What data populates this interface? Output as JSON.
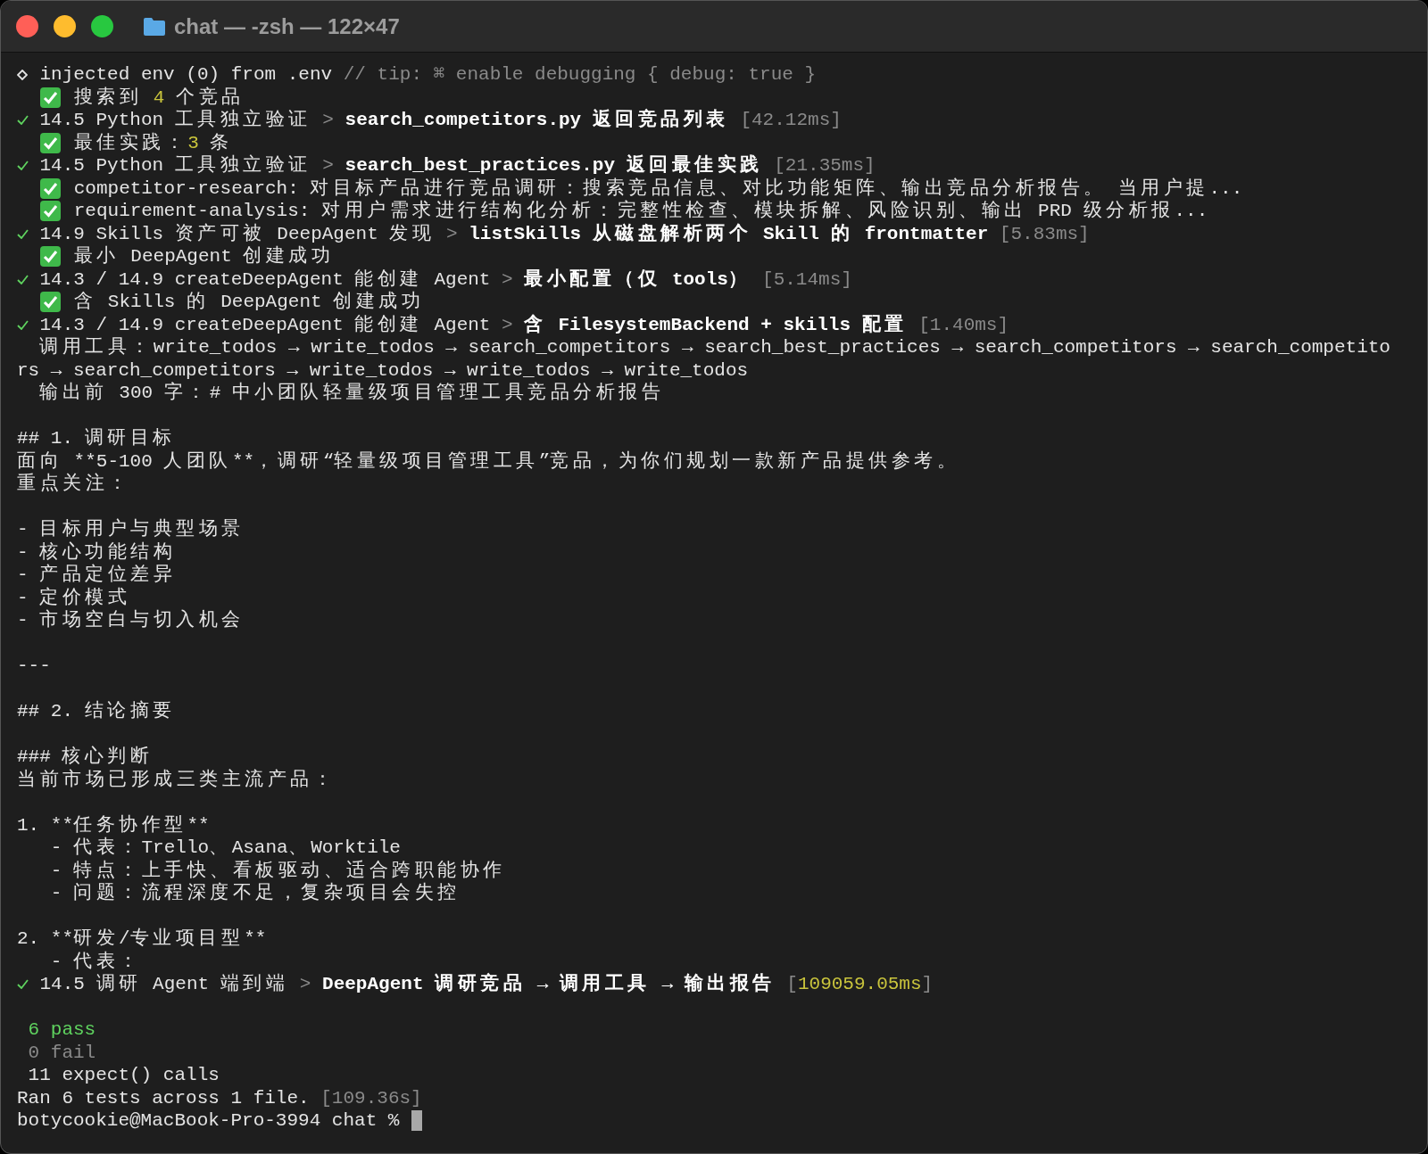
{
  "window": {
    "title": "chat — -zsh — 122×47"
  },
  "lines": [
    {
      "kind": "diamond",
      "segments": [
        {
          "text": "injected env (0) from .env ",
          "kind": "plain"
        },
        {
          "text": "// tip: ⌘ enable debugging { debug: true }",
          "kind": "dim"
        }
      ]
    },
    {
      "kind": "emoji",
      "segments": [
        {
          "text": "搜索到 ",
          "kind": "plain"
        },
        {
          "text": "4",
          "kind": "yellow"
        },
        {
          "text": " 个竞品",
          "kind": "plain"
        }
      ]
    },
    {
      "kind": "tick",
      "segments": [
        {
          "text": "14.5 Python 工具独立验证 ",
          "kind": "plain"
        },
        {
          "text": "> ",
          "kind": "dim"
        },
        {
          "text": "search_competitors.py 返回竞品列表",
          "kind": "bold"
        },
        {
          "text": " [42.12ms]",
          "kind": "dim"
        }
      ]
    },
    {
      "kind": "emoji",
      "segments": [
        {
          "text": "最佳实践：",
          "kind": "plain"
        },
        {
          "text": "3",
          "kind": "yellow"
        },
        {
          "text": " 条",
          "kind": "plain"
        }
      ]
    },
    {
      "kind": "tick",
      "segments": [
        {
          "text": "14.5 Python 工具独立验证 ",
          "kind": "plain"
        },
        {
          "text": "> ",
          "kind": "dim"
        },
        {
          "text": "search_best_practices.py 返回最佳实践",
          "kind": "bold"
        },
        {
          "text": " [21.35ms]",
          "kind": "dim"
        }
      ]
    },
    {
      "kind": "emoji",
      "segments": [
        {
          "text": "competitor-research: 对目标产品进行竞品调研：搜索竞品信息、对比功能矩阵、输出竞品分析报告。 当用户提...",
          "kind": "plain"
        }
      ]
    },
    {
      "kind": "emoji",
      "segments": [
        {
          "text": "requirement-analysis: 对用户需求进行结构化分析：完整性检查、模块拆解、风险识别、输出 PRD 级分析报...",
          "kind": "plain"
        }
      ]
    },
    {
      "kind": "tick",
      "segments": [
        {
          "text": "14.9 Skills 资产可被 DeepAgent 发现 ",
          "kind": "plain"
        },
        {
          "text": "> ",
          "kind": "dim"
        },
        {
          "text": "listSkills 从磁盘解析两个 Skill 的 frontmatter",
          "kind": "bold"
        },
        {
          "text": " [5.83ms]",
          "kind": "dim"
        }
      ]
    },
    {
      "kind": "emoji",
      "segments": [
        {
          "text": "最小 DeepAgent 创建成功",
          "kind": "plain"
        }
      ]
    },
    {
      "kind": "tick",
      "segments": [
        {
          "text": "14.3 / 14.9 createDeepAgent 能创建 Agent ",
          "kind": "plain"
        },
        {
          "text": "> ",
          "kind": "dim"
        },
        {
          "text": "最小配置（仅 tools）",
          "kind": "bold"
        },
        {
          "text": " [5.14ms]",
          "kind": "dim"
        }
      ]
    },
    {
      "kind": "emoji",
      "segments": [
        {
          "text": "含 Skills 的 DeepAgent 创建成功",
          "kind": "plain"
        }
      ]
    },
    {
      "kind": "tick",
      "segments": [
        {
          "text": "14.3 / 14.9 createDeepAgent 能创建 Agent ",
          "kind": "plain"
        },
        {
          "text": "> ",
          "kind": "dim"
        },
        {
          "text": "含 FilesystemBackend + skills 配置",
          "kind": "bold"
        },
        {
          "text": " [1.40ms]",
          "kind": "dim"
        }
      ]
    },
    {
      "kind": "plain",
      "segments": [
        {
          "text": "  调用工具：write_todos → write_todos → search_competitors → search_best_practices → search_competitors → search_competito",
          "kind": "plain"
        }
      ]
    },
    {
      "kind": "plain",
      "segments": [
        {
          "text": "rs → search_competitors → write_todos → write_todos → write_todos",
          "kind": "plain"
        }
      ]
    },
    {
      "kind": "plain",
      "segments": [
        {
          "text": "  输出前 300 字：# 中小团队轻量级项目管理工具竞品分析报告",
          "kind": "plain"
        }
      ]
    },
    {
      "kind": "blank"
    },
    {
      "kind": "plain",
      "segments": [
        {
          "text": "## 1. 调研目标",
          "kind": "plain"
        }
      ]
    },
    {
      "kind": "plain",
      "segments": [
        {
          "text": "面向 **5-100 人团队**，调研“轻量级项目管理工具”竞品，为你们规划一款新产品提供参考。",
          "kind": "plain"
        }
      ]
    },
    {
      "kind": "plain",
      "segments": [
        {
          "text": "重点关注：",
          "kind": "plain"
        }
      ]
    },
    {
      "kind": "blank"
    },
    {
      "kind": "plain",
      "segments": [
        {
          "text": "- 目标用户与典型场景",
          "kind": "plain"
        }
      ]
    },
    {
      "kind": "plain",
      "segments": [
        {
          "text": "- 核心功能结构",
          "kind": "plain"
        }
      ]
    },
    {
      "kind": "plain",
      "segments": [
        {
          "text": "- 产品定位差异",
          "kind": "plain"
        }
      ]
    },
    {
      "kind": "plain",
      "segments": [
        {
          "text": "- 定价模式",
          "kind": "plain"
        }
      ]
    },
    {
      "kind": "plain",
      "segments": [
        {
          "text": "- 市场空白与切入机会",
          "kind": "plain"
        }
      ]
    },
    {
      "kind": "blank"
    },
    {
      "kind": "plain",
      "segments": [
        {
          "text": "---",
          "kind": "plain"
        }
      ]
    },
    {
      "kind": "blank"
    },
    {
      "kind": "plain",
      "segments": [
        {
          "text": "## 2. 结论摘要",
          "kind": "plain"
        }
      ]
    },
    {
      "kind": "blank"
    },
    {
      "kind": "plain",
      "segments": [
        {
          "text": "### 核心判断",
          "kind": "plain"
        }
      ]
    },
    {
      "kind": "plain",
      "segments": [
        {
          "text": "当前市场已形成三类主流产品：",
          "kind": "plain"
        }
      ]
    },
    {
      "kind": "blank"
    },
    {
      "kind": "plain",
      "segments": [
        {
          "text": "1. **任务协作型**",
          "kind": "plain"
        }
      ]
    },
    {
      "kind": "plain",
      "segments": [
        {
          "text": "   - 代表：Trello、Asana、Worktile",
          "kind": "plain"
        }
      ]
    },
    {
      "kind": "plain",
      "segments": [
        {
          "text": "   - 特点：上手快、看板驱动、适合跨职能协作",
          "kind": "plain"
        }
      ]
    },
    {
      "kind": "plain",
      "segments": [
        {
          "text": "   - 问题：流程深度不足，复杂项目会失控",
          "kind": "plain"
        }
      ]
    },
    {
      "kind": "blank"
    },
    {
      "kind": "plain",
      "segments": [
        {
          "text": "2. **研发/专业项目型**",
          "kind": "plain"
        }
      ]
    },
    {
      "kind": "plain",
      "segments": [
        {
          "text": "   - 代表：",
          "kind": "plain"
        }
      ]
    },
    {
      "kind": "tick",
      "segments": [
        {
          "text": "14.5 调研 Agent 端到端 ",
          "kind": "plain"
        },
        {
          "text": "> ",
          "kind": "dim"
        },
        {
          "text": "DeepAgent 调研竞品 → 调用工具 → 输出报告",
          "kind": "bold"
        },
        {
          "text": " [",
          "kind": "dim"
        },
        {
          "text": "109059.05ms",
          "kind": "yellow"
        },
        {
          "text": "]",
          "kind": "dim"
        }
      ]
    },
    {
      "kind": "blank"
    },
    {
      "kind": "plain",
      "segments": [
        {
          "text": " 6 pass",
          "kind": "green"
        }
      ]
    },
    {
      "kind": "plain",
      "segments": [
        {
          "text": " 0 fail",
          "kind": "dim"
        }
      ]
    },
    {
      "kind": "plain",
      "segments": [
        {
          "text": " 11 expect() calls",
          "kind": "plain"
        }
      ]
    },
    {
      "kind": "plain",
      "segments": [
        {
          "text": "Ran 6 tests across 1 file. ",
          "kind": "plain"
        },
        {
          "text": "[109.36s]",
          "kind": "dim"
        }
      ]
    },
    {
      "kind": "prompt",
      "segments": [
        {
          "text": "botycookie@MacBook-Pro-3994 chat % ",
          "kind": "plain"
        }
      ]
    }
  ]
}
